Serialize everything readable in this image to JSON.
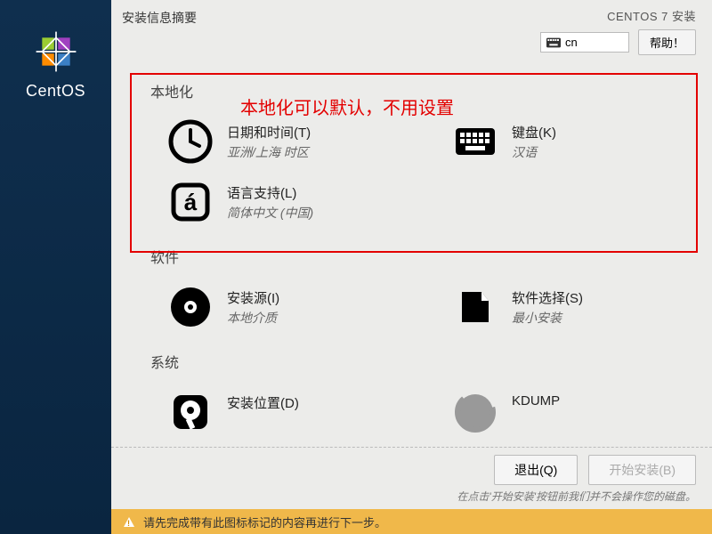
{
  "sidebar": {
    "brand": "CentOS"
  },
  "topbar": {
    "title": "安装信息摘要",
    "subtitle": "CENTOS 7 安装",
    "lang_indicator": "cn",
    "help_label": "帮助！"
  },
  "annotation": "本地化可以默认，不用设置",
  "sections": {
    "localization": {
      "header": "本地化",
      "datetime": {
        "title": "日期和时间(T)",
        "sub": "亚洲/上海 时区"
      },
      "keyboard": {
        "title": "键盘(K)",
        "sub": "汉语"
      },
      "language": {
        "title": "语言支持(L)",
        "sub": "简体中文 (中国)"
      }
    },
    "software": {
      "header": "软件",
      "source": {
        "title": "安装源(I)",
        "sub": "本地介质"
      },
      "selection": {
        "title": "软件选择(S)",
        "sub": "最小安装"
      }
    },
    "system": {
      "header": "系统",
      "destination": {
        "title": "安装位置(D)",
        "sub": ""
      },
      "kdump": {
        "title": "KDUMP",
        "sub": ""
      }
    }
  },
  "footer": {
    "quit_label": "退出(Q)",
    "begin_label": "开始安装(B)",
    "hint": "在点击'开始安装'按钮前我们并不会操作您的磁盘。"
  },
  "warning": "请先完成带有此图标标记的内容再进行下一步。"
}
